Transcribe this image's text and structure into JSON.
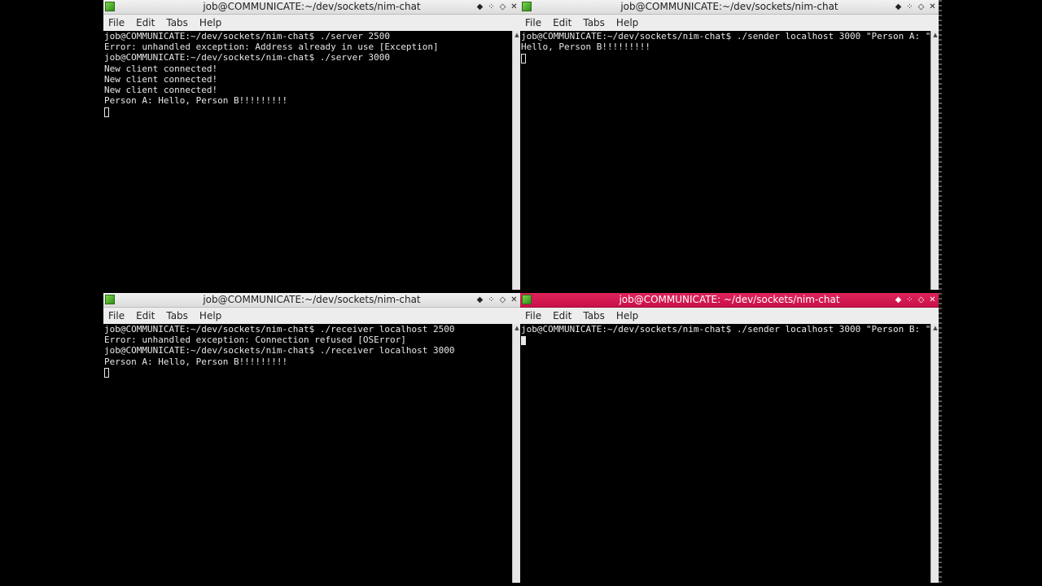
{
  "windows": {
    "tl": {
      "title": "job@COMMUNICATE:~/dev/sockets/nim-chat",
      "menus": [
        "File",
        "Edit",
        "Tabs",
        "Help"
      ],
      "lines": [
        "job@COMMUNICATE:~/dev/sockets/nim-chat$ ./server 2500",
        "Error: unhandled exception: Address already in use [Exception]",
        "job@COMMUNICATE:~/dev/sockets/nim-chat$ ./server 3000",
        "New client connected!",
        "New client connected!",
        "New client connected!",
        "Person A: Hello, Person B!!!!!!!!!"
      ]
    },
    "tr": {
      "title": "job@COMMUNICATE:~/dev/sockets/nim-chat",
      "menus": [
        "File",
        "Edit",
        "Tabs",
        "Help"
      ],
      "lines": [
        "job@COMMUNICATE:~/dev/sockets/nim-chat$ ./sender localhost 3000 \"Person A: \"",
        "Hello, Person B!!!!!!!!!"
      ]
    },
    "bl": {
      "title": "job@COMMUNICATE:~/dev/sockets/nim-chat",
      "menus": [
        "File",
        "Edit",
        "Tabs",
        "Help"
      ],
      "lines": [
        "job@COMMUNICATE:~/dev/sockets/nim-chat$ ./receiver localhost 2500",
        "Error: unhandled exception: Connection refused [OSError]",
        "job@COMMUNICATE:~/dev/sockets/nim-chat$ ./receiver localhost 3000",
        "Person A: Hello, Person B!!!!!!!!!"
      ]
    },
    "br": {
      "title": "job@COMMUNICATE: ~/dev/sockets/nim-chat",
      "menus": [
        "File",
        "Edit",
        "Tabs",
        "Help"
      ],
      "lines": [
        "job@COMMUNICATE:~/dev/sockets/nim-chat$ ./sender localhost 3000 \"Person B: \""
      ]
    }
  },
  "title_buttons": {
    "sticky": "◆",
    "shade": "⁘",
    "maximize": "◇",
    "close": "✕"
  },
  "colors": {
    "active_titlebar": "#d41a50",
    "inactive_titlebar": "#e8e8e8",
    "terminal_bg": "#000000",
    "terminal_fg": "#e8e8e8"
  },
  "icons": {
    "window": "terminal-icon",
    "scroll_up": "▲",
    "scroll_down": "▼"
  }
}
